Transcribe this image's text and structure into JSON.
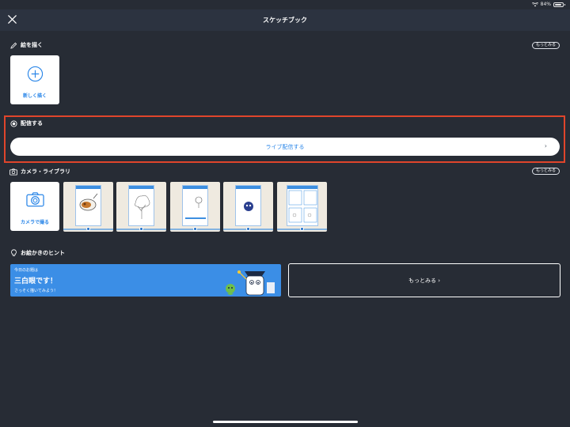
{
  "status_bar": {
    "battery": "84%"
  },
  "nav": {
    "title": "スケッチブック"
  },
  "draw_section": {
    "title": "絵を描く",
    "more_label": "もっとみる",
    "new_card_label": "新しく描く"
  },
  "live_section": {
    "title": "配信する",
    "button_label": "ライブ配信する",
    "highlight_color": "#e0452b"
  },
  "camera_section": {
    "title": "カメラ・ライブラリ",
    "more_label": "もっとみる",
    "camera_card_label": "カメラで撮る",
    "thumbnails": [
      "curry-drawing",
      "tree-sketch",
      "balloon-sketch",
      "creature-drawing",
      "grid-worksheet"
    ]
  },
  "hint_section": {
    "title": "お絵かきのヒント",
    "banner_kicker": "今日のお題は",
    "banner_headline": "三白眼です！",
    "banner_sub": "さっそく描いてみよう！",
    "more_button_label": "もっとみる ›"
  },
  "colors": {
    "background": "#272c35",
    "navbar": "#2c3340",
    "accent_blue": "#2a86e8",
    "banner_blue": "#3b8ee6"
  }
}
